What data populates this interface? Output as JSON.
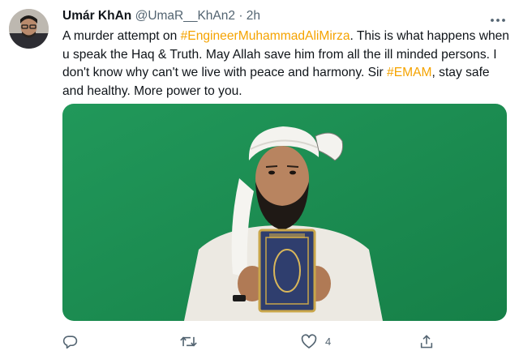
{
  "tweet": {
    "author_name": "Umár KhAn",
    "handle": "@UmaR__KhAn2",
    "separator": " · ",
    "time": "2h",
    "text": {
      "p1": "A murder attempt on ",
      "tag1": "#EngineerMuhammadAliMirza",
      "p2": ". This is what happens when u speak the Haq & Truth. May Allah save him from all the ill minded persons. I don't know why can't we live with peace and harmony. Sir ",
      "tag2": "#EMAM",
      "p3": ", stay safe and healthy. More power to you."
    },
    "media": {
      "background_color": "#1e8f4c"
    },
    "actions": {
      "reply_count": "",
      "retweet_count": "",
      "like_count": "4"
    }
  },
  "icons": [
    "avatar",
    "more-icon",
    "reply-icon",
    "retweet-icon",
    "like-icon",
    "share-icon"
  ],
  "colors": {
    "hashtag": "#f5a300",
    "muted": "#536471",
    "text": "#0f1419",
    "media_green": "#1e8f4c"
  }
}
